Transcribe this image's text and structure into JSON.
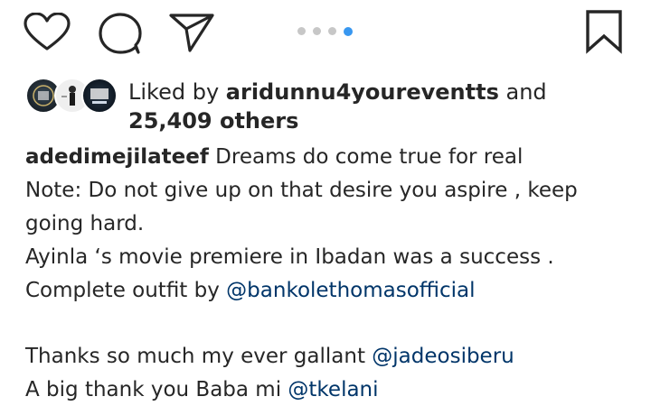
{
  "actions": {
    "like_icon": "heart-outline-icon",
    "comment_icon": "comment-bubble-icon",
    "share_icon": "paper-plane-icon",
    "save_icon": "bookmark-outline-icon"
  },
  "carousel": {
    "total": 4,
    "active_index": 4,
    "active_color": "#3897f0",
    "inactive_color": "#c7c7c7"
  },
  "likes": {
    "prefix": "Liked by",
    "user": "aridunnu4youreventts",
    "connector": "and",
    "others": "25,409 others"
  },
  "caption": {
    "author": "adedimejilateef",
    "line1_text": " Dreams do come true for real",
    "line2": "Note: Do not give up on that desire you aspire , keep",
    "line3": "going hard.",
    "line4": "Ayinla ‘s movie premiere in Ibadan was a success .",
    "line5_text": "Complete outfit by ",
    "line5_mention": "@bankolethomasofficial",
    "line7_text": "Thanks so much my ever gallant ",
    "line7_mention": "@jadeosiberu",
    "line8_text": "A big thank you Baba mi ",
    "line8_mention": "@tkelani"
  },
  "colors": {
    "text": "#262626",
    "mention": "#003569"
  }
}
